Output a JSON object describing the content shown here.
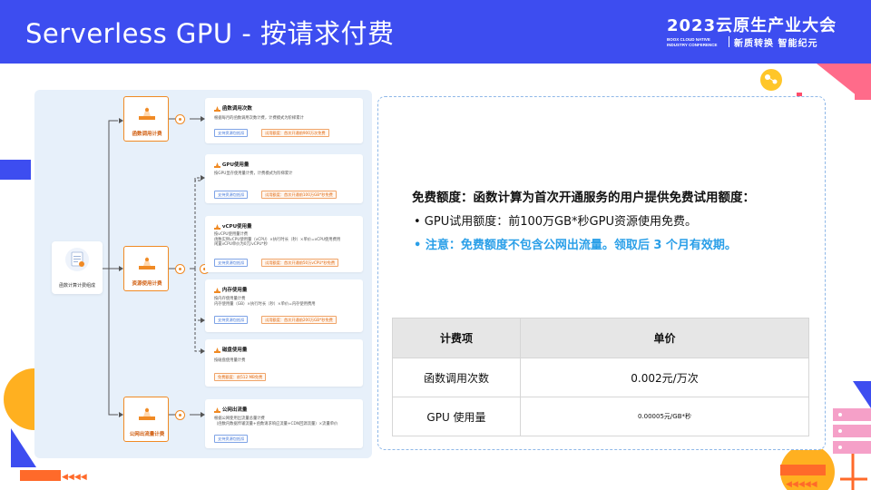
{
  "header": {
    "title": "Serverless GPU - 按请求付费",
    "brand_top": "2023云原生产业大会",
    "brand_en": "BOOX CLOUD NATIVE INDUSTRY CONFERENCE",
    "brand_slogan": "新质转换 智能纪元"
  },
  "diagram": {
    "root_label": "函数计算计费组成",
    "categories": [
      {
        "label": "函数调用计费"
      },
      {
        "label": "资源使用计费"
      },
      {
        "label": "公网出流量计费"
      }
    ],
    "items": [
      {
        "title": "函数调用次数",
        "desc": "根据每月的函数调用次数计费，计费模式为阶梯累计",
        "tag_blue": "支持资源包抵扣",
        "tag_orange": "试用额度：首次开通前900万次免费"
      },
      {
        "title": "GPU使用量",
        "desc": "按GPU显存使用量计费，计费模式为阶梯累计",
        "tag_blue": "支持资源包抵扣",
        "tag_orange": "试用额度：首次开通前100万GB*秒免费"
      },
      {
        "title": "vCPU使用量",
        "desc": "按vCPU使用量计费\n函数实例vCPU使用量（vCPU）×执行时长（秒）×单价=vCPU使用费用\n闲置vCPU单价为0元/vCPU*秒",
        "tag_blue": "支持资源包抵扣",
        "tag_orange": "试用额度：首次开通前50万vCPU*秒免费"
      },
      {
        "title": "内存使用量",
        "desc": "按内存使用量计费\n内存使用量（GB）×执行时长（秒）×单价=内存使用费用",
        "tag_blue": "支持资源包抵扣",
        "tag_orange": "试用额度：首次开通前200万GB*秒免费"
      },
      {
        "title": "磁盘使用量",
        "desc": "按磁盘使用量计费",
        "tag_blue": "",
        "tag_orange": "免费额度：前512 MB免费"
      },
      {
        "title": "公网出流量",
        "desc": "根据公网使用出流量总量计费\n（函数内数据传输流量+函数请求响应流量+CDN回源流量）×流量单价",
        "tag_blue": "支持资源包抵扣",
        "tag_orange": ""
      }
    ]
  },
  "free_quota": {
    "title": "免费额度：函数计算为首次开通服务的用户提供免费试用额度：",
    "line1": "• GPU试用额度：前100万GB*秒GPU资源使用免费。",
    "line2": "• 注意：免费额度不包含公网出流量。领取后 3 个月有效期。"
  },
  "price_table": {
    "headers": [
      "计费项",
      "单价"
    ],
    "rows": [
      [
        "函数调用次数",
        "0.002元/万次"
      ],
      [
        "GPU 使用量",
        "0.00005元/GB*秒"
      ]
    ]
  },
  "colors": {
    "header_bg": "#3d4df0",
    "accent_orange": "#f08a24",
    "note_blue": "#2a9fe8"
  }
}
